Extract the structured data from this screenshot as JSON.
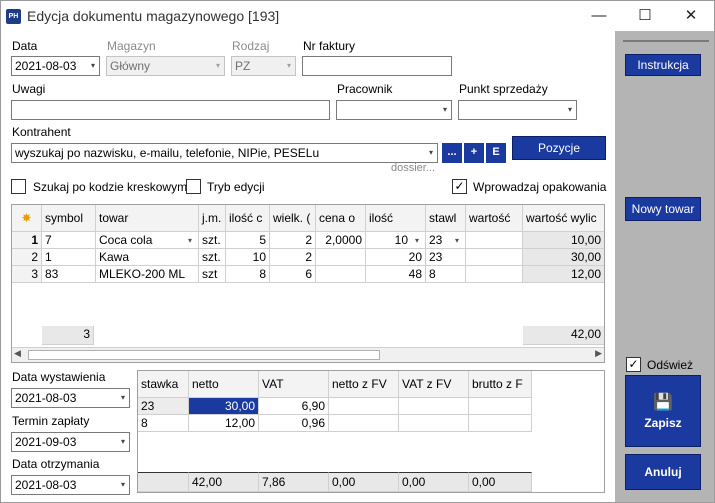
{
  "window": {
    "app_icon": "PH",
    "title": "Edycja dokumentu magazynowego [193]",
    "minimize": "—",
    "maximize": "☐",
    "close": "✕"
  },
  "form": {
    "data_label": "Data",
    "data_value": "2021-08-03",
    "magazyn_label": "Magazyn",
    "magazyn_value": "Główny",
    "rodzaj_label": "Rodzaj",
    "rodzaj_value": "PZ",
    "nr_faktury_label": "Nr faktury",
    "nr_faktury_value": "",
    "uwagi_label": "Uwagi",
    "uwagi_value": "",
    "pracownik_label": "Pracownik",
    "pracownik_value": "",
    "punkt_label": "Punkt sprzedaży",
    "punkt_value": "",
    "kontrahent_label": "Kontrahent",
    "kontrahent_placeholder": "wyszukaj po nazwisku, e-mailu, telefonie, NIPie, PESELu",
    "btn_ellipsis": "...",
    "btn_plus": "+",
    "btn_e": "E",
    "dossier": "dossier...",
    "pozycje": "Pozycje",
    "chk_barcode": "Szukaj po kodzie kreskowym",
    "chk_barcode_checked": false,
    "chk_edit": "Tryb edycji",
    "chk_edit_checked": false,
    "chk_pack": "Wprowadzaj opakowania",
    "chk_pack_checked": true
  },
  "grid": {
    "headers": [
      "symbol",
      "towar",
      "j.m.",
      "ilość c",
      "wielk. (",
      "cena o",
      "ilość",
      "stawl",
      "wartość",
      "wartość wylic"
    ],
    "rows": [
      {
        "n": "1",
        "symbol": "7",
        "towar": "Coca cola",
        "jm": "szt.",
        "ilosc_c": "5",
        "wielk": "2",
        "cena": "2,0000",
        "ilosc": "10",
        "stawka": "23",
        "wartosc": "",
        "wartosc_wyl": "10,00"
      },
      {
        "n": "2",
        "symbol": "1",
        "towar": "Kawa",
        "jm": "szt.",
        "ilosc_c": "10",
        "wielk": "2",
        "cena": "",
        "ilosc": "20",
        "stawka": "23",
        "wartosc": "",
        "wartosc_wyl": "30,00"
      },
      {
        "n": "3",
        "symbol": "83",
        "towar": "MLEKO-200 ML",
        "jm": "szt",
        "ilosc_c": "8",
        "wielk": "6",
        "cena": "",
        "ilosc": "48",
        "stawka": "8",
        "wartosc": "",
        "wartosc_wyl": "12,00"
      }
    ],
    "footer_count": "3",
    "footer_total": "42,00",
    "new_row_icon": "asterisk-icon"
  },
  "dates": {
    "wystawienia_label": "Data wystawienia",
    "wystawienia_value": "2021-08-03",
    "zaplaty_label": "Termin zapłaty",
    "zaplaty_value": "2021-09-03",
    "otrzymania_label": "Data otrzymania",
    "otrzymania_value": "2021-08-03"
  },
  "vat": {
    "headers": [
      "stawka",
      "netto",
      "VAT",
      "netto z FV",
      "VAT z FV",
      "brutto z F"
    ],
    "rows": [
      {
        "stawka": "23",
        "netto": "30,00",
        "vat": "6,90"
      },
      {
        "stawka": "8",
        "netto": "12,00",
        "vat": "0,96"
      }
    ],
    "totals": {
      "netto": "42,00",
      "vat": "7,86",
      "netto_fv": "0,00",
      "vat_fv": "0,00",
      "brutto_fv": "0,00"
    }
  },
  "right": {
    "instrukcja": "Instrukcja",
    "nowy_towar": "Nowy towar",
    "odswiez": "Odśwież",
    "odswiez_checked": true,
    "zapisz": "Zapisz",
    "anuluj": "Anuluj"
  },
  "colors": {
    "accent": "#1a3aa0",
    "selected_cell": "#1a3aa0",
    "panel": "#b4b4b4"
  }
}
